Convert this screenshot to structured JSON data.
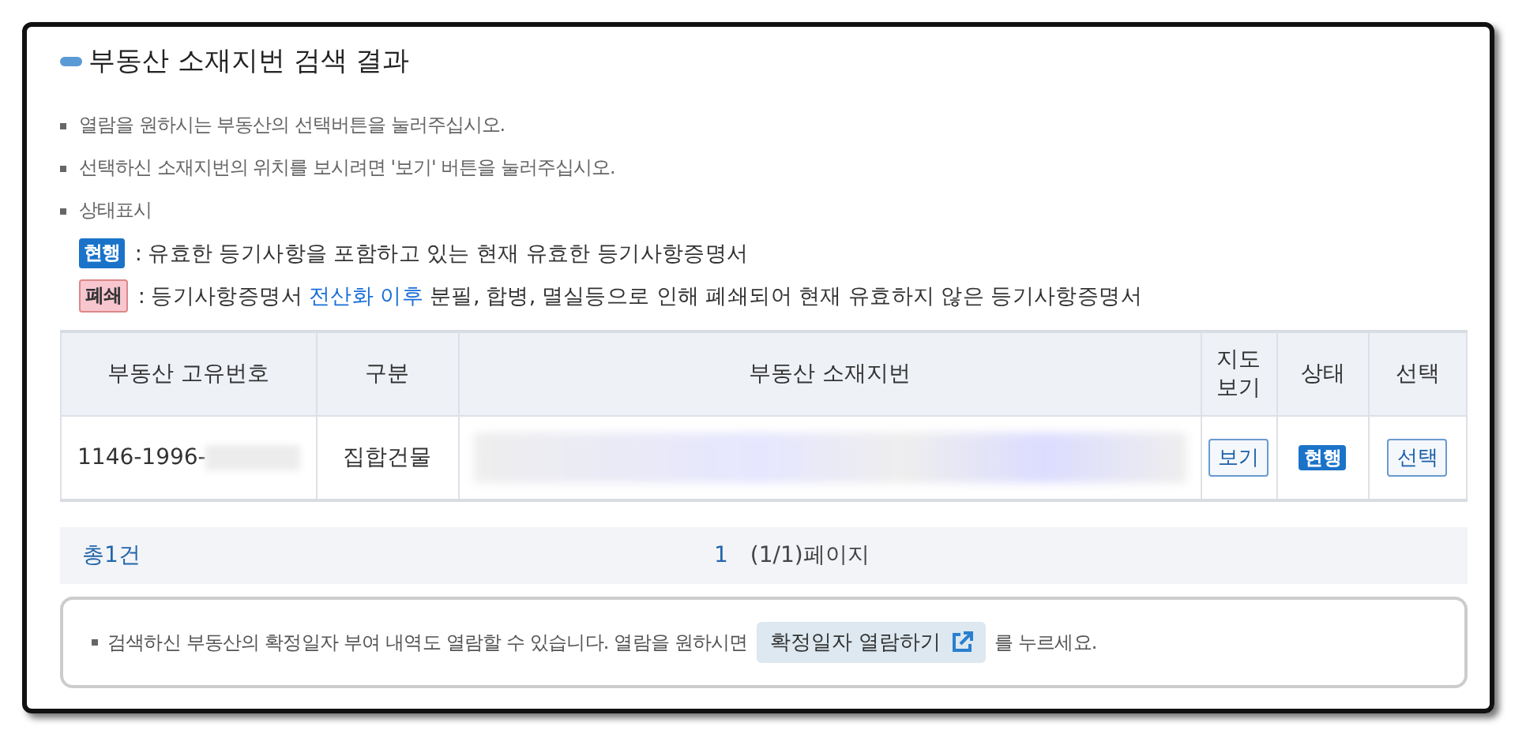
{
  "title": "부동산 소재지번 검색 결과",
  "notes": [
    "열람을 원하시는 부동산의 선택버튼을 눌러주십시오.",
    "선택하신 소재지번의 위치를 보시려면 '보기' 버튼을 눌러주십시오.",
    "상태표시"
  ],
  "legend": [
    {
      "badge": "현행",
      "kind": "current",
      "parts": [
        {
          "text": ": 유효한 등기사항을 포함하고 있는 현재 유효한 등기사항증명서",
          "link": false
        }
      ]
    },
    {
      "badge": "폐쇄",
      "kind": "closed",
      "parts": [
        {
          "text": ": 등기사항증명서 ",
          "link": false
        },
        {
          "text": "전산화 이후",
          "link": true
        },
        {
          "text": " 분필, 합병, 멸실등으로 인해 폐쇄되어 현재 유효하지 않은 등기사항증명서",
          "link": false
        }
      ]
    }
  ],
  "table": {
    "columns": [
      "부동산 고유번호",
      "구분",
      "부동산 소재지번",
      "지도 보기",
      "상태",
      "선택"
    ],
    "rows": [
      {
        "number": "1146-1996-",
        "number_redacted": true,
        "type": "집합건물",
        "address_redacted": true,
        "map_button": "보기",
        "status": {
          "text": "현행",
          "kind": "current"
        },
        "select_button": "선택"
      }
    ]
  },
  "summary": {
    "total": "총1건",
    "page": "1",
    "page_info": "(1/1)페이지"
  },
  "notice": {
    "before": "검색하신 부동산의 확정일자 부여 내역도 열람할 수 있습니다. 열람을 원하시면",
    "button": "확정일자 열람하기",
    "after": "를 누르세요."
  }
}
